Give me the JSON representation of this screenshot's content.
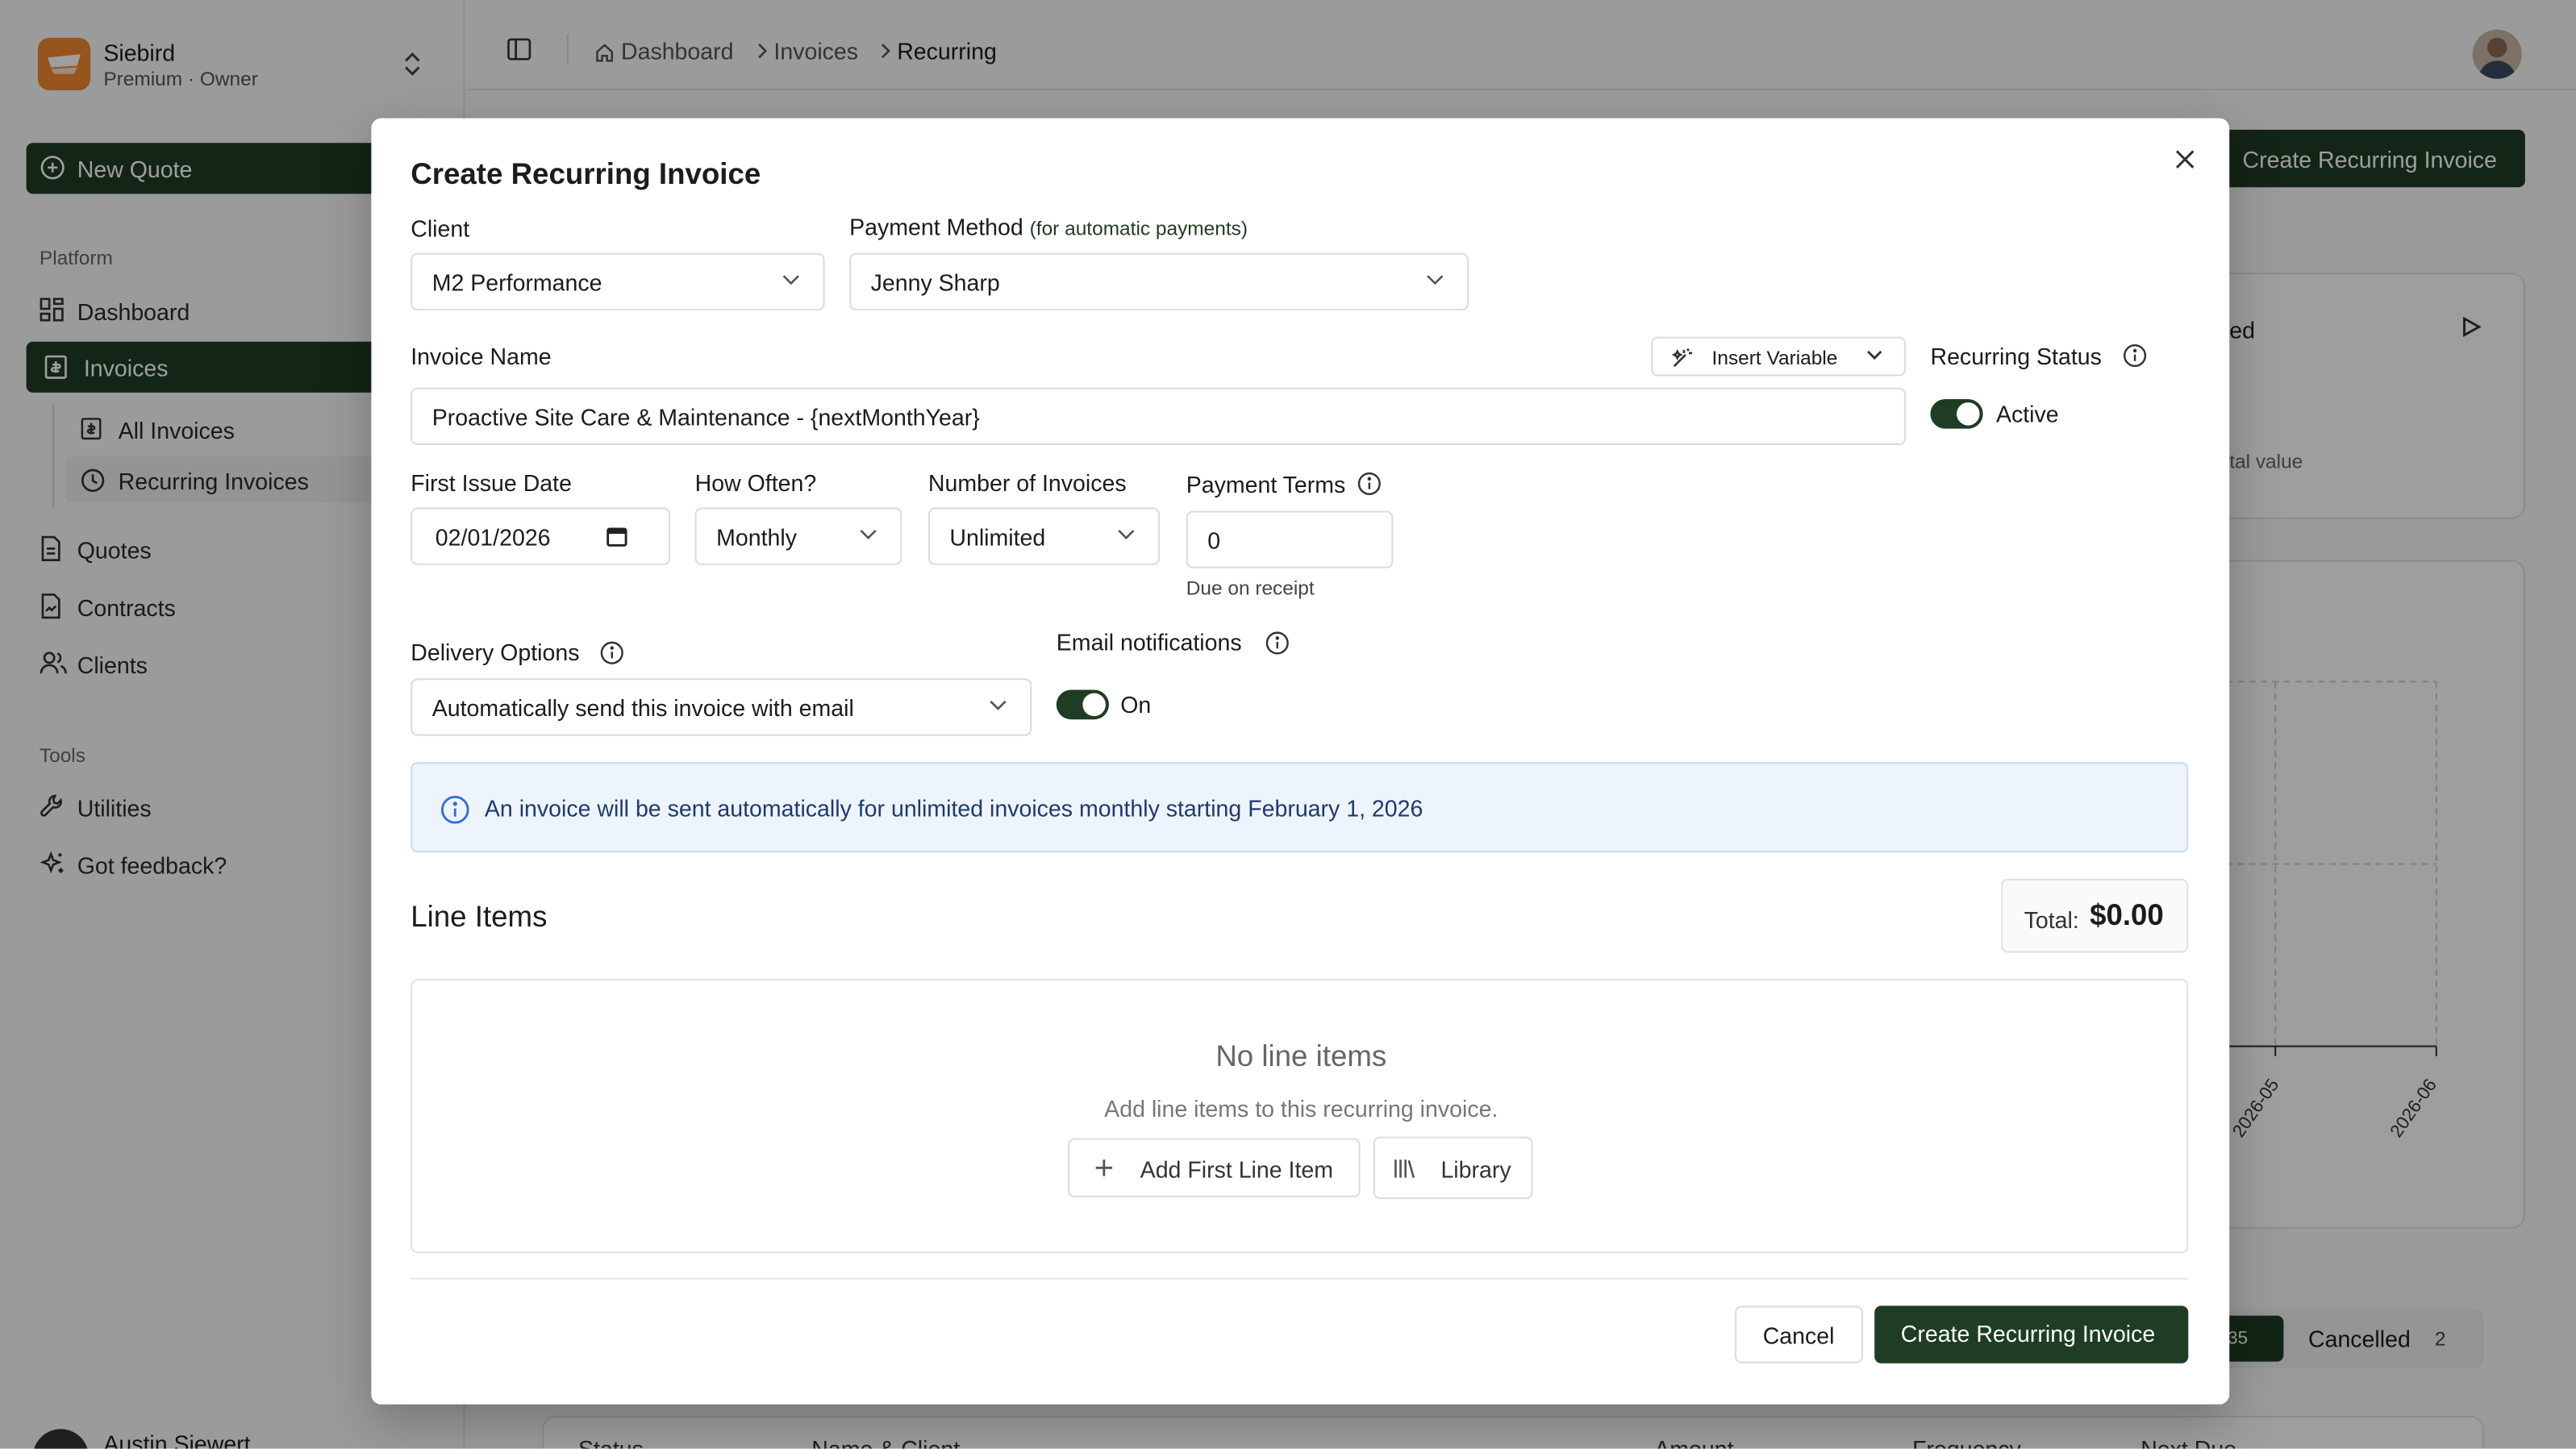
{
  "colors": {
    "brand": "#1f3d24",
    "accent_org": "#f08a2e",
    "info_bg": "#eef4fd",
    "info_text": "#1e3a6e"
  },
  "org": {
    "name": "Siebird",
    "plan": "Premium · Owner"
  },
  "sidebar": {
    "new_quote": "New Quote",
    "platform_title": "Platform",
    "tools_title": "Tools",
    "items": {
      "dashboard": "Dashboard",
      "invoices": "Invoices",
      "all_invoices": "All Invoices",
      "recurring_invoices": "Recurring Invoices",
      "quotes": "Quotes",
      "contracts": "Contracts",
      "clients": "Clients",
      "utilities": "Utilities",
      "feedback": "Got feedback?"
    },
    "user_name": "Austin Siewert"
  },
  "breadcrumb": [
    "Dashboard",
    "Invoices",
    "Recurring"
  ],
  "background": {
    "create_button": "Create Recurring Invoice",
    "card_title_fragment": "ed",
    "card_sub_fragment": "tal value",
    "chart_ticks": [
      "2026-05",
      "2026-06"
    ],
    "tabs": {
      "active_count": "35",
      "cancelled_label": "Cancelled",
      "cancelled_count": "2"
    },
    "table_headers": [
      "Status",
      "Name & Client",
      "Amount",
      "Frequency",
      "Next Due"
    ]
  },
  "modal": {
    "title": "Create Recurring Invoice",
    "client": {
      "label": "Client",
      "value": "M2 Performance"
    },
    "payment_method": {
      "label": "Payment Method",
      "hint": "(for automatic payments)",
      "value": "Jenny Sharp"
    },
    "invoice_name": {
      "label": "Invoice Name",
      "value": "Proactive Site Care & Maintenance - {nextMonthYear}"
    },
    "insert_variable": "Insert Variable",
    "recurring_status": {
      "label": "Recurring Status",
      "value": "Active",
      "on": true
    },
    "first_issue_date": {
      "label": "First Issue Date",
      "value": "02/01/2026"
    },
    "how_often": {
      "label": "How Often?",
      "value": "Monthly"
    },
    "number_of_invoices": {
      "label": "Number of Invoices",
      "value": "Unlimited"
    },
    "payment_terms": {
      "label": "Payment Terms",
      "value": "0",
      "note": "Due on receipt"
    },
    "delivery_options": {
      "label": "Delivery Options",
      "value": "Automatically send this invoice with email"
    },
    "email_notifications": {
      "label": "Email notifications",
      "value": "On",
      "on": true
    },
    "info_banner": "An invoice will be sent automatically for unlimited invoices monthly starting February 1, 2026",
    "line_items": {
      "title": "Line Items",
      "total_label": "Total:",
      "total_value": "$0.00",
      "empty_title": "No line items",
      "empty_sub": "Add line items to this recurring invoice.",
      "add_first": "Add First Line Item",
      "library": "Library"
    },
    "cancel": "Cancel",
    "submit": "Create Recurring Invoice"
  }
}
